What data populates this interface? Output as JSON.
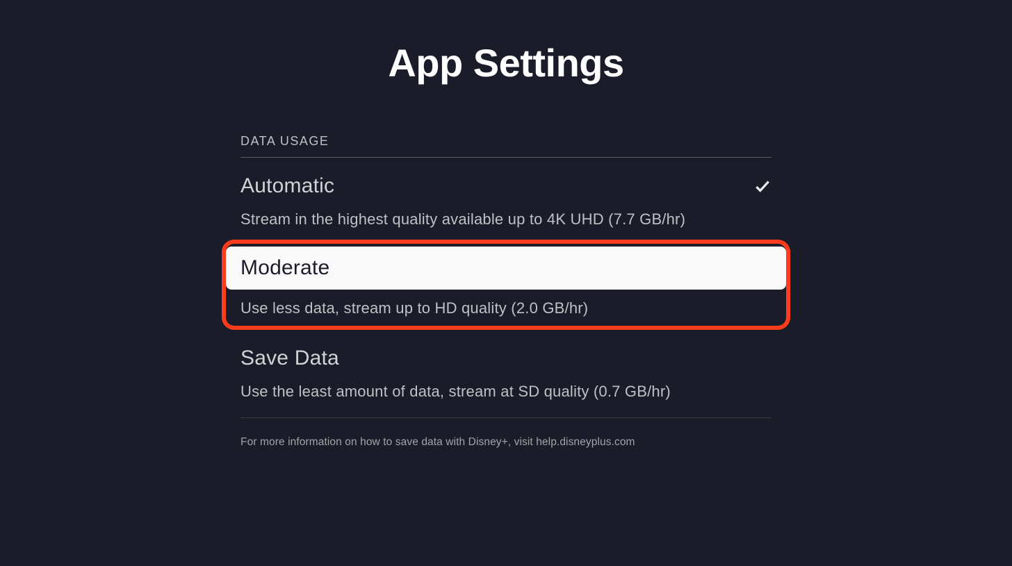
{
  "page_title": "App Settings",
  "section": {
    "header": "DATA USAGE",
    "options": [
      {
        "title": "Automatic",
        "description": "Stream in the highest quality available up to 4K UHD (7.7 GB/hr)",
        "selected": true,
        "highlighted": false
      },
      {
        "title": "Moderate",
        "description": "Use less data, stream up to HD quality (2.0 GB/hr)",
        "selected": false,
        "highlighted": true
      },
      {
        "title": "Save Data",
        "description": "Use the least amount of data, stream at SD quality (0.7 GB/hr)",
        "selected": false,
        "highlighted": false
      }
    ],
    "footer": "For more information on how to save data with Disney+, visit help.disneyplus.com"
  }
}
